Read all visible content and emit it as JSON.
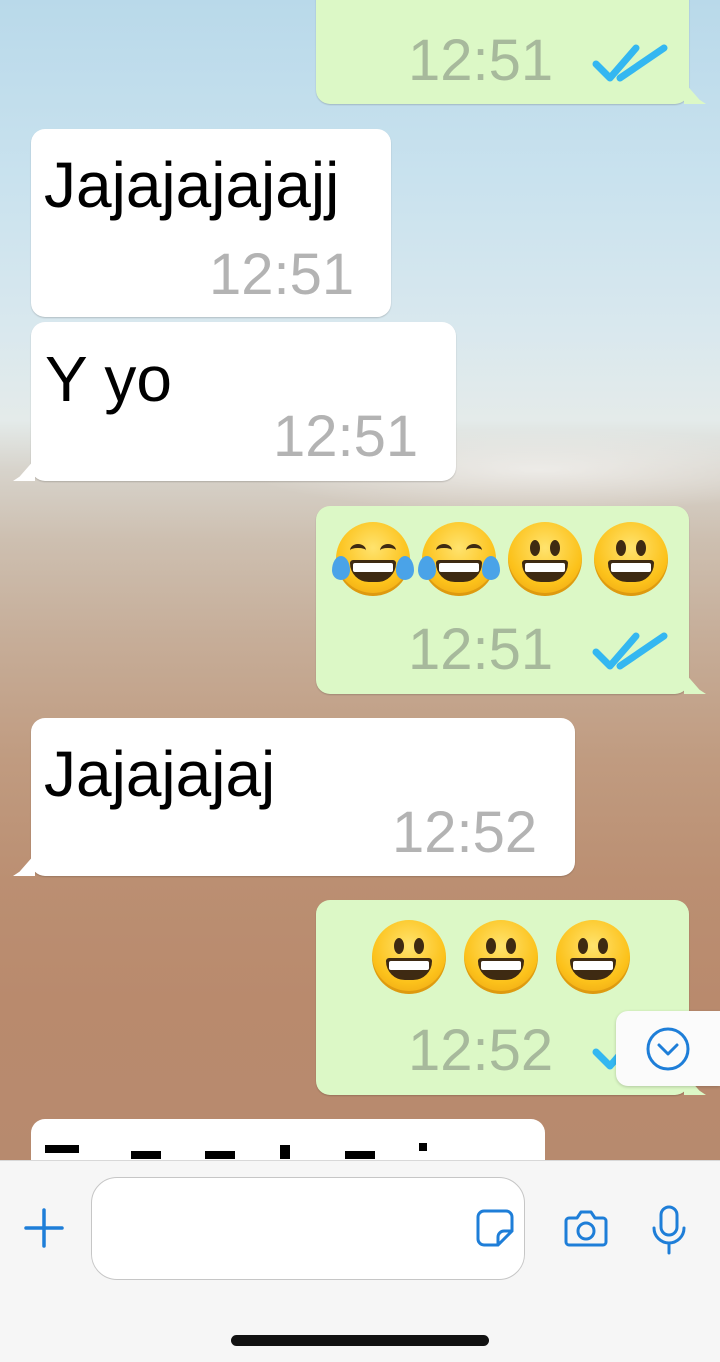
{
  "messages": [
    {
      "direction": "out",
      "text": "",
      "time": "12:51",
      "status": "read",
      "partial": true
    },
    {
      "direction": "in",
      "text": "Jajajajajajj",
      "time": "12:51"
    },
    {
      "direction": "in",
      "text": "Y yo",
      "time": "12:51"
    },
    {
      "direction": "out",
      "emojis": [
        "face-with-tears-of-joy",
        "face-with-tears-of-joy",
        "grinning-face",
        "grinning-face"
      ],
      "time": "12:51",
      "status": "read"
    },
    {
      "direction": "in",
      "text": "Jajajajaj",
      "time": "12:52"
    },
    {
      "direction": "out",
      "emojis": [
        "grinning-face",
        "grinning-face",
        "smiling-face-with-open-mouth"
      ],
      "time": "12:52",
      "status": "read"
    },
    {
      "direction": "in",
      "text": "",
      "partial": true
    }
  ],
  "scroll_button": {
    "icon": "chevron-down-circle-icon"
  },
  "composer": {
    "add_icon": "plus-icon",
    "input_value": "",
    "input_placeholder": "",
    "sticker_icon": "sticker-icon",
    "camera_icon": "camera-icon",
    "mic_icon": "microphone-icon"
  },
  "colors": {
    "incoming_bubble": "#ffffff",
    "outgoing_bubble": "#dcf8c6",
    "read_ticks": "#34b7f1",
    "accent": "#1e7ed8"
  }
}
